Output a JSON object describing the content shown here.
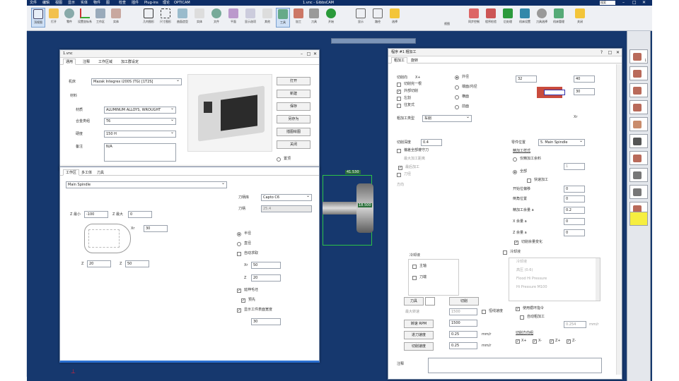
{
  "app": {
    "title": "1.vnc - GibbsCAM",
    "right_label": "搜索"
  },
  "menu": [
    "文件",
    "编辑",
    "视图",
    "显示",
    "实体",
    "物件",
    "图",
    "检查",
    "插件",
    "Plug-ins",
    "理论",
    "OPTICAM"
  ],
  "ribbon": {
    "groups": [
      {
        "label": "顶视图"
      },
      {
        "label": "打开"
      },
      {
        "label": "零件"
      },
      {
        "label": "设置坐标系"
      },
      {
        "label": "工作区"
      },
      {
        "label": "实体"
      },
      {
        "label": "几何图形"
      },
      {
        "label": "尺寸图形"
      },
      {
        "label": "曲面造型"
      },
      {
        "label": "实体"
      },
      {
        "label": "文件"
      },
      {
        "label": "平面"
      },
      {
        "label": "显示选项"
      },
      {
        "label": "其他"
      },
      {
        "label": "工具"
      },
      {
        "label": "加工"
      },
      {
        "label": "刀具"
      },
      {
        "label": "开始"
      },
      {
        "label": "显示"
      },
      {
        "label": "路径"
      },
      {
        "label": "选择"
      },
      {
        "label": "同步控制"
      },
      {
        "label": "程序检验"
      },
      {
        "label": "后处理"
      },
      {
        "label": "机床设置"
      },
      {
        "label": "刀具选择"
      },
      {
        "label": "机床管理"
      },
      {
        "label": "关闭"
      }
    ],
    "view_label": "视图"
  },
  "doc_dialog": {
    "title": "1.vnc",
    "tabs": [
      "通用",
      "注释",
      "工作区域",
      "加工群设定"
    ],
    "machine_label": "机床",
    "machine_value": "Mazak Integrex i200S (TG) [1T2S]",
    "material_section": "材料",
    "material_label": "材质",
    "material_value": "ALUMINUM ALLOYS, WROUGHT",
    "unit_label": "合金类组",
    "unit_value": "T6",
    "hardness_label": "硬度",
    "hardness_value": "150 H",
    "notes_label": "备注",
    "notes_value": "N/A",
    "buttons": [
      "打开",
      "新建",
      "保存",
      "另存为",
      "插图绘图",
      "关闭"
    ],
    "pin_label": "置顶"
  },
  "part_dialog": {
    "tabs": [
      "工作区",
      "多工体",
      "刀具"
    ],
    "spindle": "Main Spindle",
    "z_min_label": "Z 最小",
    "z_min_value": "-100",
    "z_max_label": "Z 最大",
    "z_max_value": "0",
    "xr_label": "Xr",
    "xr_value": "30",
    "z1_label": "Z",
    "z1_value": "20",
    "z2_label": "Z",
    "z2_value": "50",
    "tool_system_label": "刀柄库",
    "tool_system_value": "Capto C6",
    "tool_len_label": "刀柄",
    "tool_len_value": "25.4",
    "radius_label": "半径",
    "diameter_label": "直径",
    "auto_label": "自动求取",
    "xr2_label": "Xr",
    "xr2_value": "50",
    "z3_label": "Z",
    "z3_value": "20",
    "stock_chk1": "延伸毛坯",
    "stock_chk2": "预先",
    "stock_chk3": "显示工件表面宽度",
    "stock_width": "30"
  },
  "viewport": {
    "dim_top": "41.530",
    "dim_mid": "18.500"
  },
  "op_dialog": {
    "title": "程序 #1 粗加工",
    "tabs": [
      "粗加工",
      "旋转"
    ],
    "cut_dir_label": "切削向",
    "cut_dir_value": "X+",
    "left_checks": [
      "切削完一根",
      "外部切削",
      "左割",
      "往复式"
    ],
    "right_radios": [
      "外径",
      "端面/内径",
      "横面",
      "前面"
    ],
    "mode_label": "粗加工类型",
    "mode_value": "车削",
    "val_32": "32",
    "val_40": "40",
    "val_30": "30",
    "xr_mark": "Xr",
    "depth_label": "切削深度",
    "depth_value": "0.4",
    "spindle_label": "零件位置",
    "spindle_value": "5. Main Spindle",
    "finish_label": "精加工样式",
    "only_finish": "仅精加工余料",
    "only_finish_val": "1",
    "all_label": "全部",
    "quick_label": "快速加工",
    "opt1": "偏差全部遵守刀",
    "opt2": "最大加工距离",
    "opt3": "最后加工",
    "shift_label": "开始位偏移",
    "shift_val": "0",
    "tilt_label": "倒角位置",
    "tilt_val": "0",
    "ex_label": "精加工余量 a",
    "ex_val": "0.2",
    "xs_label": "X 余量 a",
    "xs_val": "0",
    "zs_label": "Z 余量 a",
    "zs_val": "0",
    "fix_label": "切削余量变化",
    "dir_label": "方向",
    "sub_title": "刀径",
    "cool_label": "冷却液",
    "chk_a": "主轴",
    "chk_b": "刀端",
    "coolant_list": [
      "冷却液",
      "高压 (0.6)",
      "Flood Hi Pressure",
      "Hi Pressure M100"
    ],
    "tool_btn": "刀具",
    "tool_btn2": "切削",
    "max_label": "最大转速",
    "max_val": "1500",
    "lock_label": "恒线速度",
    "rpm_label": "转速 RPM",
    "rpm_val": "1500",
    "feed1_label": "进刀速度",
    "feed1_val": "0.25",
    "unit1": "mm/r",
    "feed2_label": "切削速度",
    "feed2_val": "0.25",
    "unit2": "mm/r",
    "pre_label": "使用循环指令",
    "rev_label": "自动粗加工",
    "rev_val": "0.254",
    "rev_unit": "mm/r",
    "axes_title": "切削方向组",
    "axes": [
      "X+",
      "X-",
      "Z+",
      "Z-"
    ],
    "notes_label": "注释"
  },
  "left_panel": {
    "items": [
      "0.80",
      "0.80",
      "2.30",
      "0.60"
    ],
    "btn": "清除"
  },
  "right_panel": {
    "count": 12
  }
}
